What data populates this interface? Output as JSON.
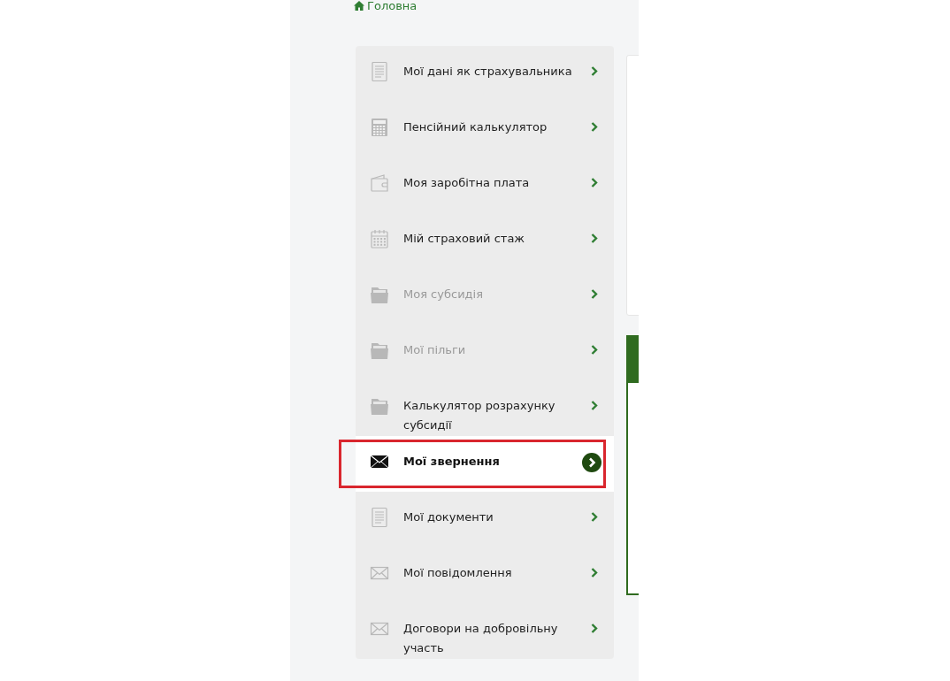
{
  "breadcrumb": {
    "label": "Головна"
  },
  "sidebar": {
    "items": [
      {
        "label": "Мої дані як страхувальника",
        "kind": "document",
        "selected": false,
        "disabled": false,
        "highlighted": false
      },
      {
        "label": "Пенсійний калькулятор",
        "kind": "calculator",
        "selected": false,
        "disabled": false,
        "highlighted": false
      },
      {
        "label": "Моя заробітна плата",
        "kind": "wallet",
        "selected": false,
        "disabled": false,
        "highlighted": false
      },
      {
        "label": "Мій страховий стаж",
        "kind": "calendar",
        "selected": false,
        "disabled": false,
        "highlighted": false
      },
      {
        "label": "Моя субсидія",
        "kind": "folder",
        "selected": false,
        "disabled": true,
        "highlighted": false
      },
      {
        "label": "Мої пільги",
        "kind": "folder",
        "selected": false,
        "disabled": true,
        "highlighted": false
      },
      {
        "label": "Калькулятор розрахунку субсидії",
        "kind": "folder",
        "selected": false,
        "disabled": false,
        "highlighted": false
      },
      {
        "label": "Мої звернення",
        "kind": "envelope",
        "selected": true,
        "disabled": false,
        "highlighted": true
      },
      {
        "label": "Мої документи",
        "kind": "document",
        "selected": false,
        "disabled": false,
        "highlighted": false
      },
      {
        "label": "Мої повідомлення",
        "kind": "envelope",
        "selected": false,
        "disabled": false,
        "highlighted": false
      },
      {
        "label": "Договори на добровільну участь",
        "kind": "envelope",
        "selected": false,
        "disabled": false,
        "highlighted": false
      }
    ]
  }
}
